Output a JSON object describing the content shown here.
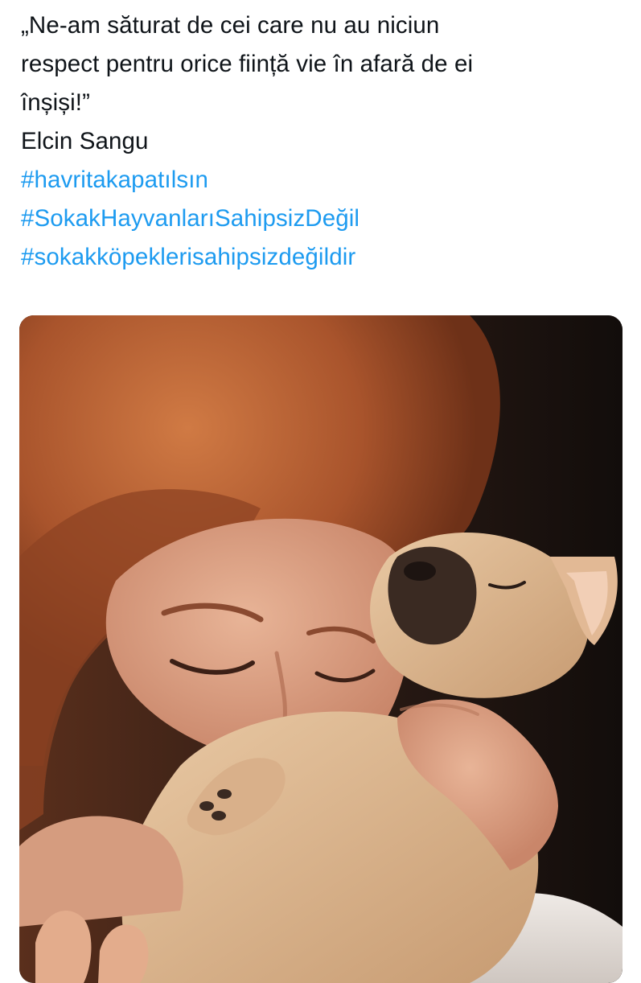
{
  "tweet": {
    "text_lines": [
      "„Ne-am săturat de cei care nu au niciun",
      "respect pentru orice ființă vie în afară de ei",
      "înșiși!”",
      "Elcin Sangu"
    ],
    "hashtags": [
      "#havritakapatılsın",
      "#SokakHayvanlarıSahipsizDeğil",
      "#sokakköpeklerisahipsizdeğildir"
    ],
    "hashtag_color": "#1d9bf0",
    "text_color": "#0f1419"
  },
  "media": {
    "type": "photo"
  }
}
